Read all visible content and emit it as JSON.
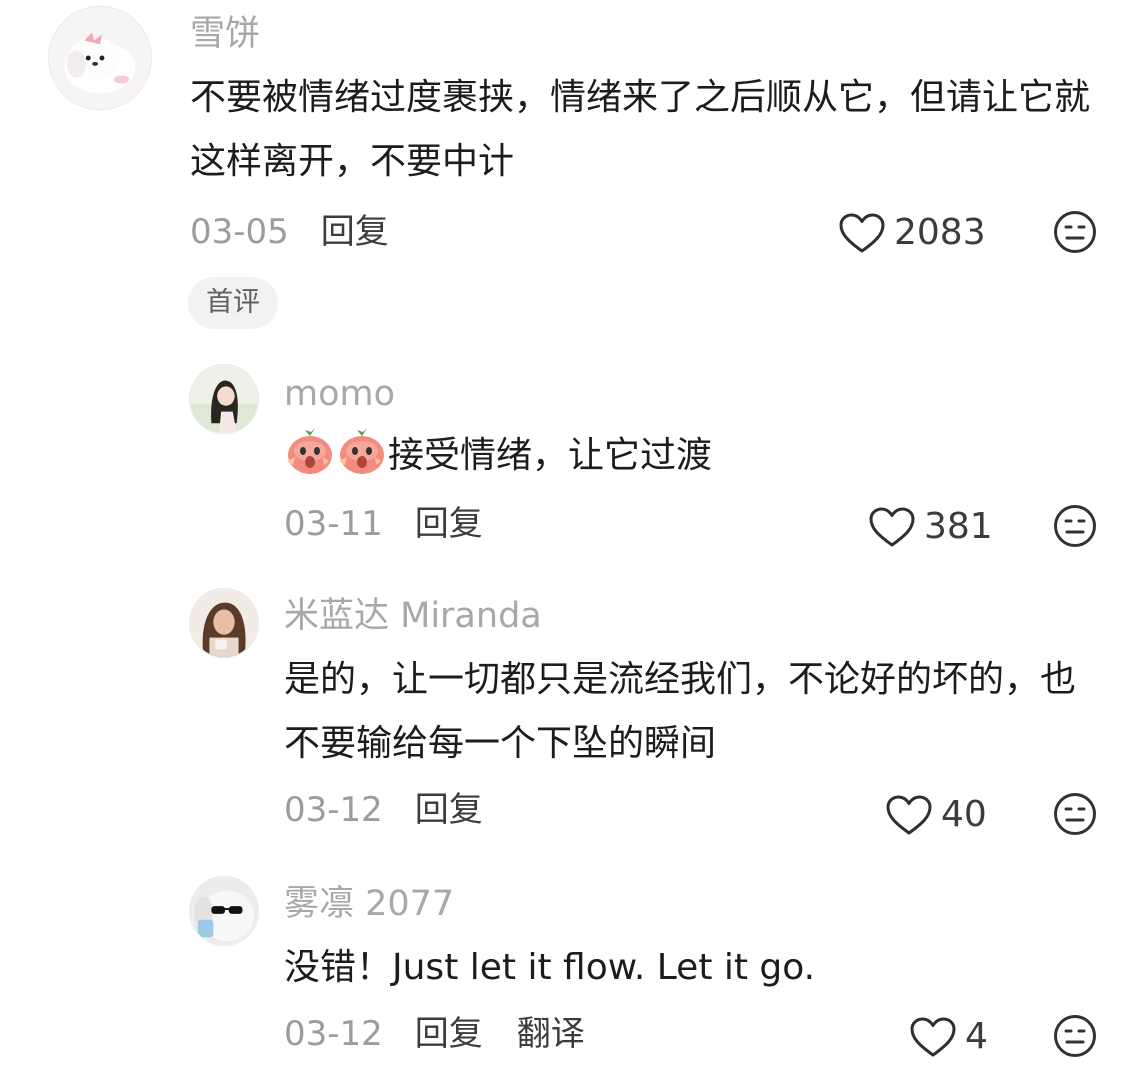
{
  "comments": [
    {
      "username": "雪饼",
      "text": "不要被情绪过度裹挟，情绪来了之后顺从它，但请让它就这样离开，不要中计",
      "date": "03-05",
      "reply_label": "回复",
      "likes": "2083",
      "badge": "首评",
      "avatar_icon": "puppy-avatar"
    }
  ],
  "replies": [
    {
      "username": "momo",
      "emoji": [
        "peach-shocked-emoji",
        "peach-shocked-emoji"
      ],
      "text": "接受情绪，让它过渡",
      "date": "03-11",
      "reply_label": "回复",
      "likes": "381",
      "avatar_icon": "girl-avatar"
    },
    {
      "username": "米蓝达 Miranda",
      "text": "是的，让一切都只是流经我们，不论好的坏的，也不要输给每一个下坠的瞬间",
      "date": "03-12",
      "reply_label": "回复",
      "likes": "40",
      "avatar_icon": "woman-avatar"
    },
    {
      "username": "雾凛 2077",
      "text": "没错！Just let it flow. Let it go.",
      "date": "03-12",
      "reply_label": "回复",
      "translate_label": "翻译",
      "likes": "4",
      "avatar_icon": "dog-sunglasses-avatar"
    }
  ],
  "colors": {
    "username": "#a8a8a8",
    "text": "#1c1c1c",
    "meta": "#9c9c9c",
    "badge_bg": "#f2f2f2"
  },
  "icons": {
    "like": "heart-outline-icon",
    "dislike": "meh-face-icon"
  }
}
